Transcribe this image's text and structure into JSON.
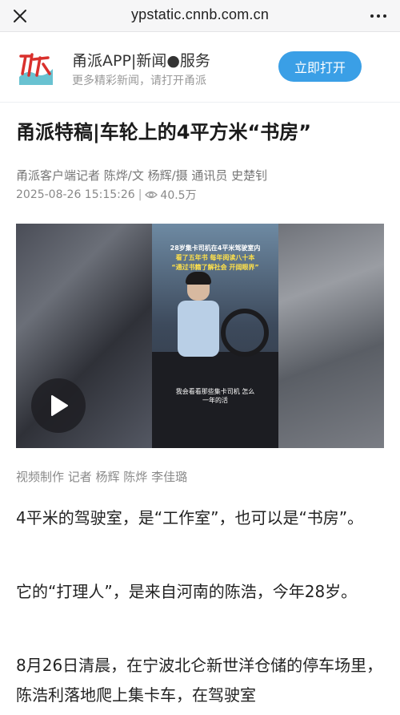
{
  "browser": {
    "url": "ypstatic.cnnb.com.cn"
  },
  "app_banner": {
    "logo_text": "派",
    "name": "甬派APP|新闻●服务",
    "subtitle": "更多精彩新闻，请打开甬派",
    "open_button": "立即打开"
  },
  "article": {
    "title": "甬派特稿|车轮上的4平方米“书房”",
    "byline": "甬派客户端记者 陈烨/文 杨辉/摄 通讯员 史楚钊",
    "date": "2025-08-26 15:15:26",
    "views": "40.5万",
    "video": {
      "caption_line1": "28岁集卡司机在4平米驾驶室内",
      "caption_line2": "看了五年书 每年阅读八十本",
      "caption_line3": "“通过书籍了解社会 开阔眼界”",
      "caption_bottom1": "我会看看那些集卡司机 怎么",
      "caption_bottom2": "一年的活"
    },
    "credit": "视频制作 记者 杨辉 陈烨 李佳璐",
    "paragraphs": [
      "4平米的驾驶室，是“工作室”，也可以是“书房”。",
      "它的“打理人”，是来自河南的陈浩，今年28岁。",
      "8月26日清晨，在宁波北仑新世洋仓储的停车场里，陈浩利落地爬上集卡车，在驾驶室"
    ]
  },
  "colors": {
    "accent": "#3a9fe6",
    "logo_red": "#d9302c",
    "logo_teal": "#4fb7c9"
  }
}
